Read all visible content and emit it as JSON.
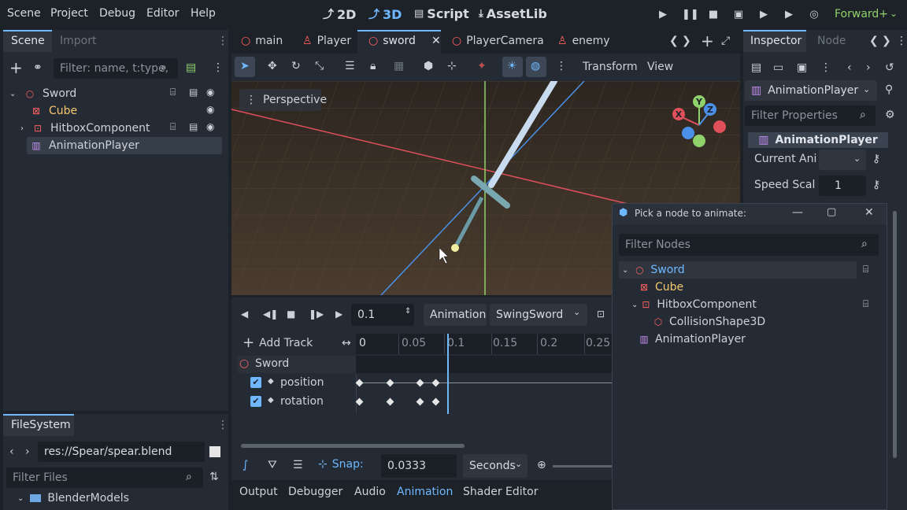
{
  "menu": [
    "Scene",
    "Project",
    "Debug",
    "Editor",
    "Help"
  ],
  "workspaces": [
    {
      "label": "2D",
      "icon": "2d-icon",
      "active": false
    },
    {
      "label": "3D",
      "icon": "3d-icon",
      "active": true
    },
    {
      "label": "Script",
      "icon": "script-icon",
      "active": false
    },
    {
      "label": "AssetLib",
      "icon": "assetlib-icon",
      "active": false
    }
  ],
  "renderer": "Forward+",
  "scene_dock": {
    "tabs": [
      "Scene",
      "Import"
    ],
    "filter_placeholder": "Filter: name, t:type,",
    "tree": [
      {
        "label": "Sword",
        "depth": 0,
        "expanded": true,
        "color": "#cdd2d9",
        "icon": "node3d-icon"
      },
      {
        "label": "Cube",
        "depth": 1,
        "color": "#f4c86e",
        "icon": "mesh-icon"
      },
      {
        "label": "HitboxComponent",
        "depth": 1,
        "collapsed": true,
        "color": "#cdd2d9",
        "icon": "area3d-icon"
      },
      {
        "label": "AnimationPlayer",
        "depth": 1,
        "color": "#cdd2d9",
        "icon": "animationplayer-icon",
        "selected": true
      }
    ]
  },
  "filesystem": {
    "title": "FileSystem",
    "path": "res://Spear/spear.blend",
    "filter_placeholder": "Filter Files",
    "folder": "BlenderModels"
  },
  "editor_tabs": [
    {
      "label": "main",
      "icon": "node3d-icon"
    },
    {
      "label": "Player",
      "icon": "character-icon"
    },
    {
      "label": "sword",
      "icon": "node3d-icon",
      "active": true
    },
    {
      "label": "PlayerCamera",
      "icon": "node3d-icon"
    },
    {
      "label": "enemy",
      "icon": "character-icon"
    }
  ],
  "viewport_toolbar": {
    "transform": "Transform",
    "view": "View"
  },
  "viewport": {
    "perspective": "Perspective",
    "gizmo": {
      "x": "X",
      "y": "Y",
      "z": "Z"
    }
  },
  "animation": {
    "time": "0.1",
    "animation_menu": "Animation",
    "current_animation": "SwingSword",
    "add_track": "Add Track",
    "ruler_ticks": [
      "0",
      "0.05",
      "0.1",
      "0.15",
      "0.2",
      "0.25"
    ],
    "root_track": "Sword",
    "tracks": [
      {
        "label": "position",
        "keys": [
          0,
          0.0333,
          0.0667,
          0.0833
        ]
      },
      {
        "label": "rotation",
        "keys": [
          0,
          0.0333,
          0.0667,
          0.0833
        ]
      }
    ],
    "snap_label": "Snap:",
    "snap_value": "0.0333",
    "snap_unit": "Seconds"
  },
  "bottom_tabs": [
    "Output",
    "Debugger",
    "Audio",
    "Animation",
    "Shader Editor"
  ],
  "inspector": {
    "tabs": [
      "Inspector",
      "Node"
    ],
    "node_type": "AnimationPlayer",
    "filter_placeholder": "Filter Properties",
    "section": "AnimationPlayer",
    "props": [
      {
        "label": "Current Ani",
        "value": ""
      },
      {
        "label": "Speed Scal",
        "value": "1"
      }
    ]
  },
  "dialog": {
    "title": "Pick a node to animate:",
    "filter_placeholder": "Filter Nodes",
    "tree": [
      {
        "label": "Sword",
        "color": "#6fb8ff",
        "icon": "node3d-icon"
      },
      {
        "label": "Cube",
        "color": "#f4c86e",
        "icon": "mesh-icon"
      },
      {
        "label": "HitboxComponent",
        "color": "#cdd2d9",
        "icon": "area3d-icon"
      },
      {
        "label": "CollisionShape3D",
        "color": "#cdd2d9",
        "icon": "collisionshape-icon"
      },
      {
        "label": "AnimationPlayer",
        "color": "#cdd2d9",
        "icon": "animationplayer-icon"
      }
    ]
  }
}
